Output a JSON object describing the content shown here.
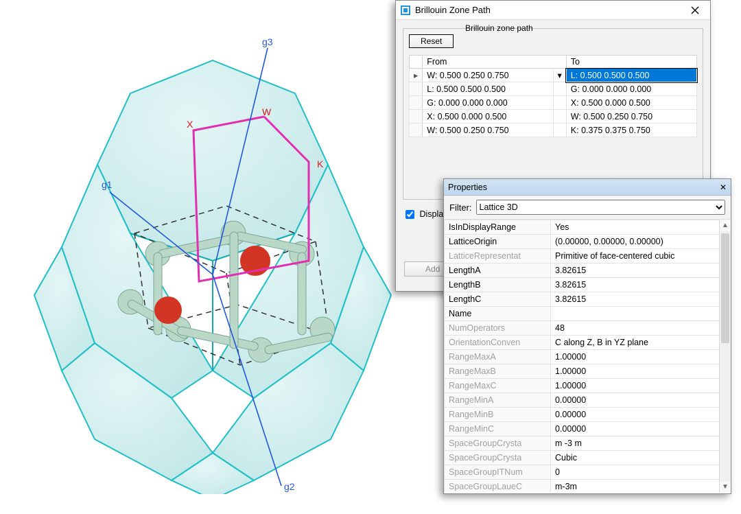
{
  "bzp": {
    "title": "Brillouin Zone Path",
    "reset_label": "Reset",
    "legend": "Brillouin zone path",
    "headers": {
      "from": "From",
      "to": "To"
    },
    "rows": [
      {
        "head": "▸",
        "from": "W:  0.500  0.250  0.750",
        "dd": "▾",
        "to": "L:  0.500  0.500  0.500",
        "to_selected": true
      },
      {
        "head": "",
        "from": "L:  0.500  0.500  0.500",
        "dd": "",
        "to": "G:  0.000  0.000  0.000",
        "to_selected": false
      },
      {
        "head": "",
        "from": "G:  0.000  0.000  0.000",
        "dd": "",
        "to": "X:  0.500  0.000  0.500",
        "to_selected": false
      },
      {
        "head": "",
        "from": "X:  0.500  0.000  0.500",
        "dd": "",
        "to": "W:  0.500  0.250  0.750",
        "to_selected": false
      },
      {
        "head": "",
        "from": "W:  0.500  0.250  0.750",
        "dd": "",
        "to": "K:  0.375  0.375  0.750",
        "to_selected": false
      }
    ],
    "display_label": "Display",
    "display_rest": "",
    "add_label": "Add"
  },
  "props": {
    "title": "Properties",
    "filter_label": "Filter:",
    "filter_value": "Lattice 3D",
    "rows": [
      {
        "k": "IsInDisplayRange",
        "v": "Yes",
        "dim": false
      },
      {
        "k": "LatticeOrigin",
        "v": "(0.00000, 0.00000, 0.00000)",
        "dim": false
      },
      {
        "k": "LatticeRepresentat",
        "v": "Primitive of face-centered cubic",
        "dim": true
      },
      {
        "k": "LengthA",
        "v": "3.82615",
        "dim": false
      },
      {
        "k": "LengthB",
        "v": "3.82615",
        "dim": false
      },
      {
        "k": "LengthC",
        "v": "3.82615",
        "dim": false
      },
      {
        "k": "Name",
        "v": "",
        "dim": false
      },
      {
        "k": "NumOperators",
        "v": "48",
        "dim": true
      },
      {
        "k": "OrientationConven",
        "v": "C along Z, B in YZ plane",
        "dim": true
      },
      {
        "k": "RangeMaxA",
        "v": "1.00000",
        "dim": true
      },
      {
        "k": "RangeMaxB",
        "v": "1.00000",
        "dim": true
      },
      {
        "k": "RangeMaxC",
        "v": "1.00000",
        "dim": true
      },
      {
        "k": "RangeMinA",
        "v": "0.00000",
        "dim": true
      },
      {
        "k": "RangeMinB",
        "v": "0.00000",
        "dim": true
      },
      {
        "k": "RangeMinC",
        "v": "0.00000",
        "dim": true
      },
      {
        "k": "SpaceGroupCrysta",
        "v": "m -3 m",
        "dim": true
      },
      {
        "k": "SpaceGroupCrysta",
        "v": "Cubic",
        "dim": true
      },
      {
        "k": "SpaceGroupITNum",
        "v": "0",
        "dim": true
      },
      {
        "k": "SpaceGroupLaueC",
        "v": "m-3m",
        "dim": true
      }
    ]
  },
  "labels3d": {
    "g1": "g1",
    "g2": "g2",
    "g3": "g3",
    "W": "W",
    "X": "X",
    "K": "K"
  }
}
